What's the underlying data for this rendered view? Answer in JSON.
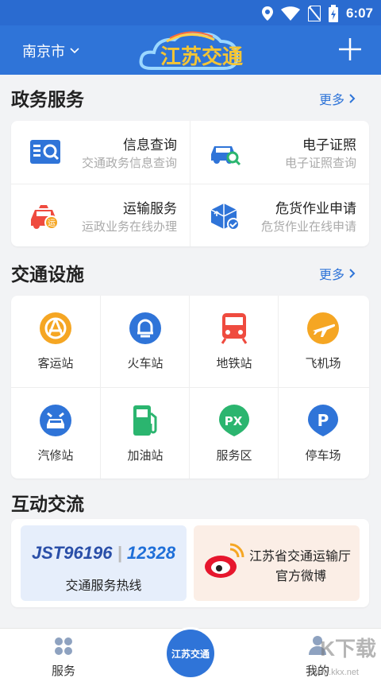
{
  "status_bar": {
    "time": "6:07"
  },
  "app_bar": {
    "city": "南京市",
    "logo_text": "江苏交通"
  },
  "gov_section": {
    "title": "政务服务",
    "more": "更多",
    "items": [
      {
        "name": "信息查询",
        "desc": "交通政务信息查询",
        "icon": "id-card-icon"
      },
      {
        "name": "电子证照",
        "desc": "电子证照查询",
        "icon": "car-search-icon"
      },
      {
        "name": "运输服务",
        "desc": "运政业务在线办理",
        "icon": "transport-car-icon",
        "badge": "运"
      },
      {
        "name": "危货作业申请",
        "desc": "危货作业在线申请",
        "icon": "hazmat-box-icon"
      }
    ]
  },
  "facility_section": {
    "title": "交通设施",
    "more": "更多",
    "items": [
      {
        "label": "客运站",
        "icon": "bus-station-icon",
        "color": "#f5a623"
      },
      {
        "label": "火车站",
        "icon": "train-station-icon",
        "color": "#2f74d8"
      },
      {
        "label": "地铁站",
        "icon": "metro-icon",
        "color": "#ef4b3f"
      },
      {
        "label": "飞机场",
        "icon": "airplane-icon",
        "color": "#f5a623"
      },
      {
        "label": "汽修站",
        "icon": "car-repair-icon",
        "color": "#2f74d8"
      },
      {
        "label": "加油站",
        "icon": "gas-pump-icon",
        "color": "#2bb56f"
      },
      {
        "label": "服务区",
        "icon": "service-area-icon",
        "color": "#2bb56f"
      },
      {
        "label": "停车场",
        "icon": "parking-icon",
        "color": "#2f74d8"
      }
    ]
  },
  "interact_section": {
    "title": "互动交流",
    "hotline": {
      "num1": "JST96196",
      "num2": "12328",
      "label": "交通服务热线"
    },
    "weibo": {
      "line1": "江苏省交通运输厅",
      "line2": "官方微博"
    }
  },
  "tab_bar": {
    "services": "服务",
    "center": "江苏交通",
    "mine": "我的"
  },
  "watermark": {
    "main": "K下载",
    "site": "www.kkx.net"
  }
}
